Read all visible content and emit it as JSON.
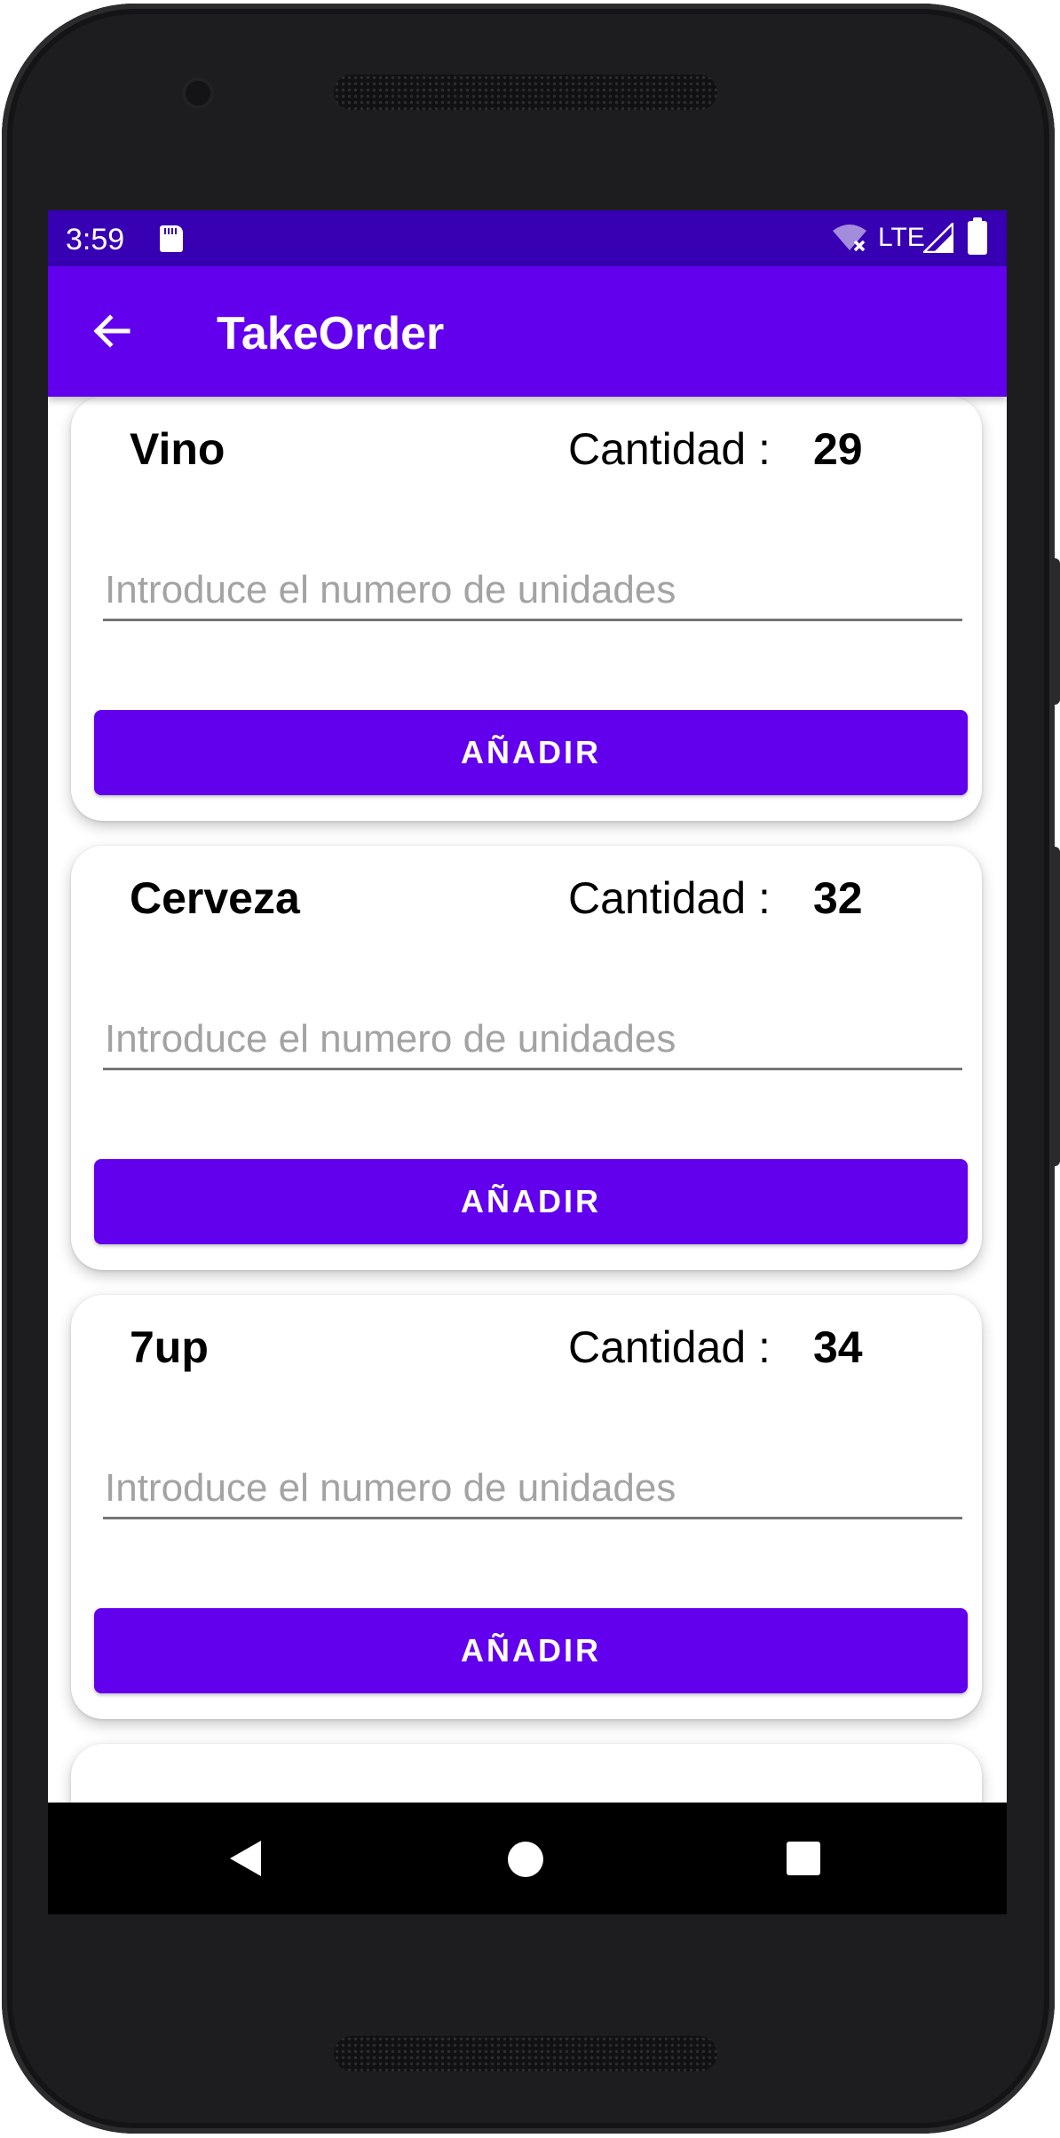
{
  "status_bar": {
    "time": "3:59",
    "network_label": "LTE",
    "icons": [
      "sd-card-icon",
      "wifi-off-icon",
      "signal-icon",
      "battery-icon"
    ]
  },
  "app_bar": {
    "title": "TakeOrder",
    "back_icon": "arrow-back-icon"
  },
  "products": [
    {
      "name": "Vino",
      "quantity_label": "Cantidad :",
      "quantity": "29",
      "input_placeholder": "Introduce el numero de unidades",
      "input_value": "",
      "add_label": "AÑADIR"
    },
    {
      "name": "Cerveza",
      "quantity_label": "Cantidad :",
      "quantity": "32",
      "input_placeholder": "Introduce el numero de unidades",
      "input_value": "",
      "add_label": "AÑADIR"
    },
    {
      "name": "7up",
      "quantity_label": "Cantidad :",
      "quantity": "34",
      "input_placeholder": "Introduce el numero de unidades",
      "input_value": "",
      "add_label": "AÑADIR"
    }
  ],
  "nav_bar": {
    "icons": [
      "nav-back-icon",
      "nav-home-icon",
      "nav-recents-icon"
    ]
  },
  "colors": {
    "primary": "#6200ee",
    "primary_dark": "#3700b3",
    "surface": "#ffffff",
    "nav_bar": "#000000"
  }
}
